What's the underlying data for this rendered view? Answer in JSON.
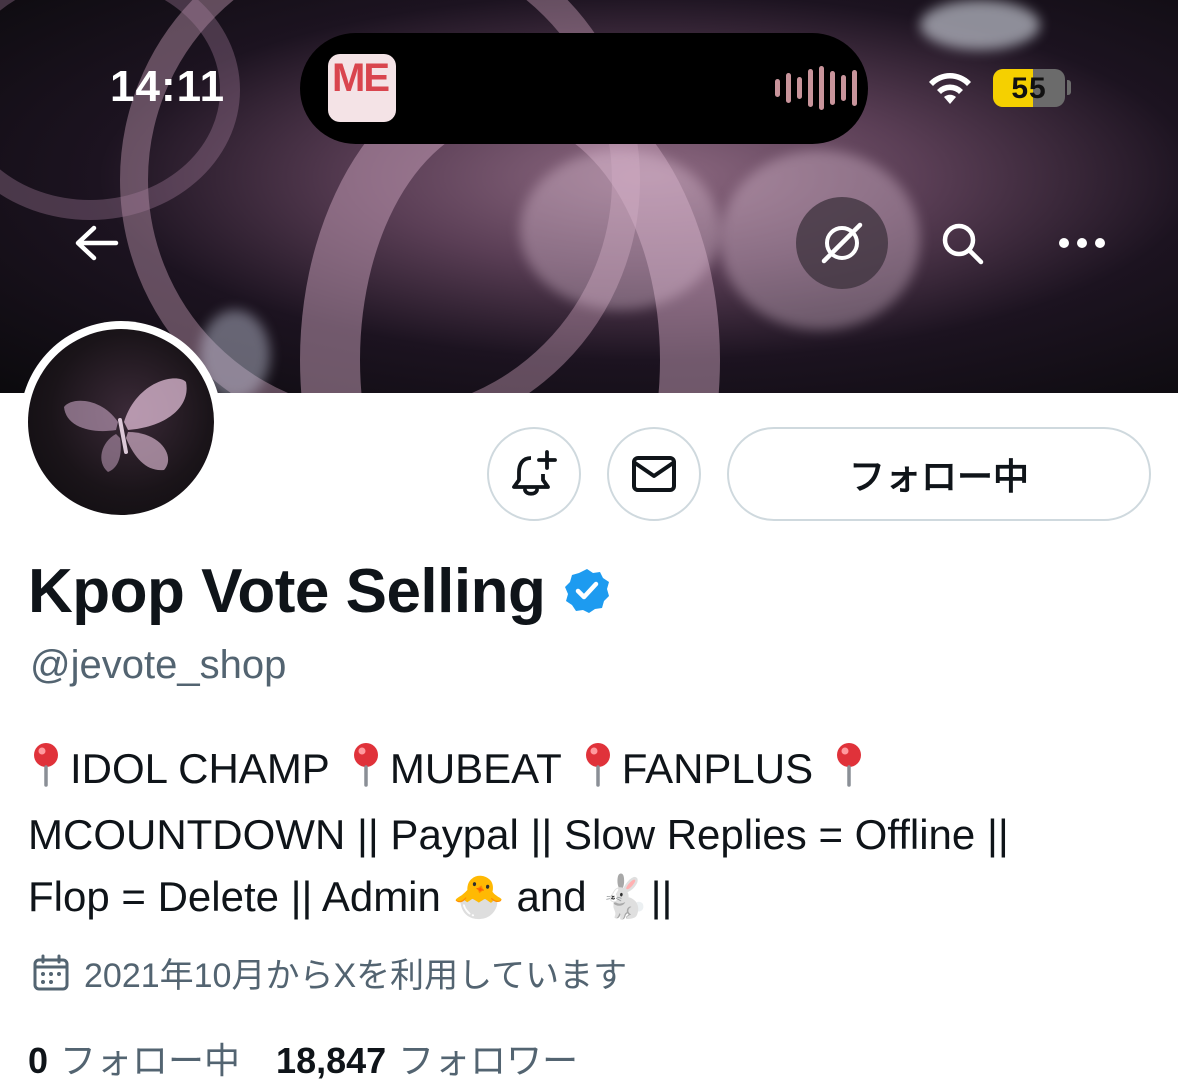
{
  "status_bar": {
    "time": "14:11",
    "now_playing_art_text": "ME",
    "battery": "55",
    "battery_level": 0.55
  },
  "nav": {
    "back_icon": "arrow-left-icon",
    "translate_icon": "globe-slash-icon",
    "search_icon": "search-icon",
    "more_icon": "more-horizontal-icon"
  },
  "actions": {
    "notify_icon": "bell-plus-icon",
    "message_icon": "envelope-icon",
    "follow_label": "フォロー中"
  },
  "profile": {
    "display_name": "Kpop Vote Selling",
    "verified": true,
    "handle": "@jevote_shop",
    "bio": {
      "line1": [
        {
          "icon": "round-pushpin",
          "text": "IDOL CHAMP"
        },
        {
          "icon": "round-pushpin",
          "text": "MUBEAT"
        },
        {
          "icon": "round-pushpin",
          "text": "FANPLUS"
        },
        {
          "icon": "round-pushpin",
          "text": ""
        }
      ],
      "line2": "MCOUNTDOWN || Paypal || Slow Replies = Offline ||",
      "line3_a": "Flop = Delete || Admin",
      "line3_b": "and",
      "line3_c": "||",
      "emoji_1": "🐣",
      "emoji_2": "🐇"
    },
    "joined": "2021年10月からXを利用しています",
    "following_count": "0",
    "following_label": "フォロー中",
    "followers_count": "18,847",
    "followers_label": "フォロワー"
  },
  "colors": {
    "text_primary": "#0f1419",
    "text_secondary": "#536471",
    "border": "#cfd9de",
    "verified_blue": "#1d9bf0",
    "pin_red": "#e0323a"
  }
}
